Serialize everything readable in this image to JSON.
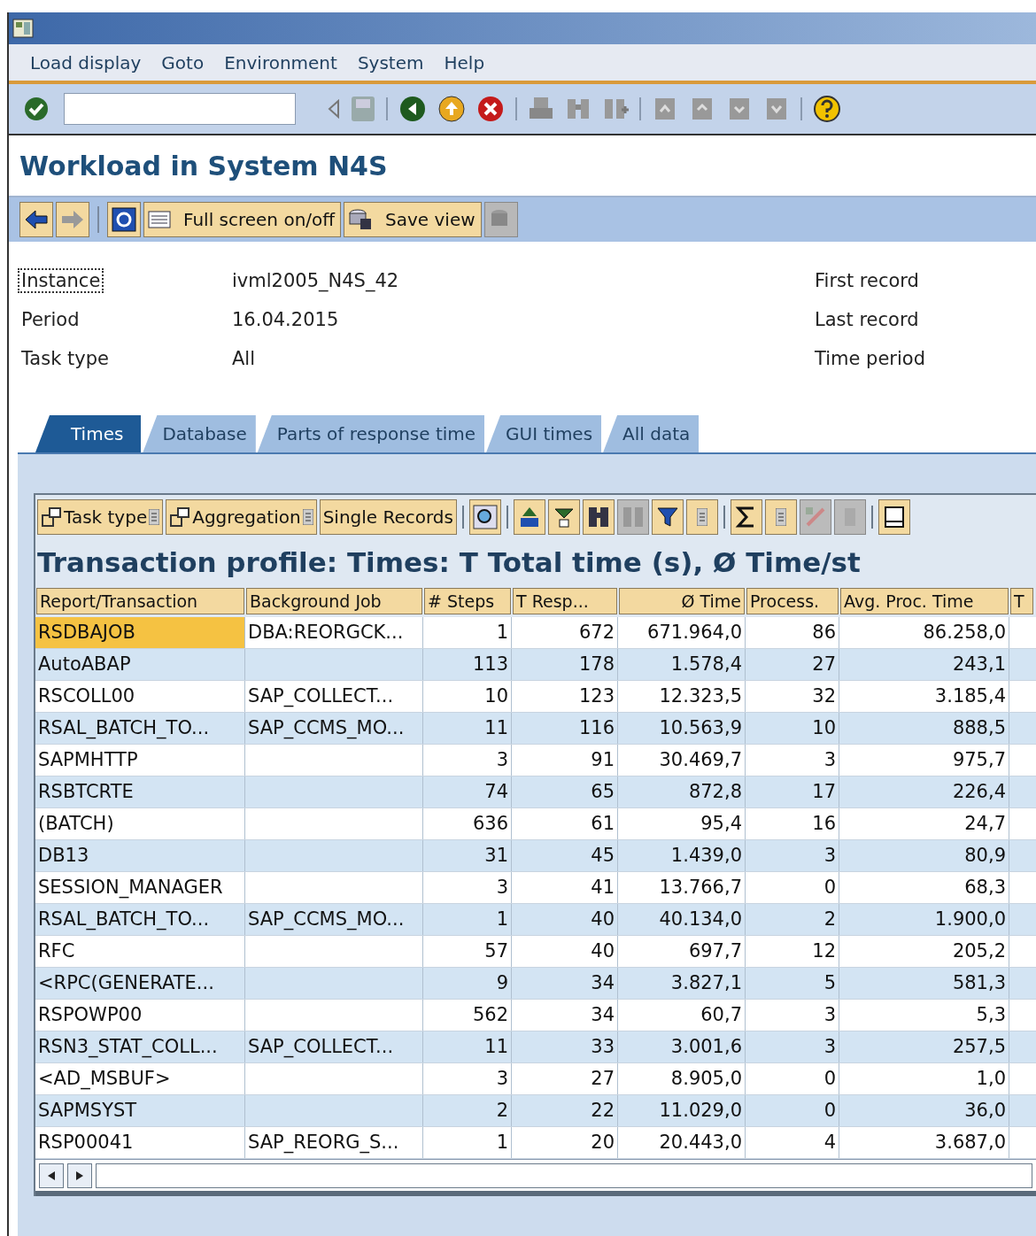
{
  "menu": [
    "Load display",
    "Goto",
    "Environment",
    "System",
    "Help"
  ],
  "title": "Workload in System N4S",
  "app_toolbar": [
    {
      "kind": "back"
    },
    {
      "kind": "forward"
    },
    {
      "kind": "refresh"
    },
    {
      "kind": "fullscreen",
      "label": "Full screen on/off"
    },
    {
      "kind": "save",
      "label": "Save view"
    },
    {
      "kind": "disabled"
    }
  ],
  "info_left": [
    {
      "label": "Instance",
      "value": "ivml2005_N4S_42",
      "focused": true
    },
    {
      "label": "Period",
      "value": "16.04.2015",
      "focused": false
    },
    {
      "label": "Task type",
      "value": "All",
      "focused": false
    }
  ],
  "info_right": [
    "First record",
    "Last record",
    "Time period"
  ],
  "tabs": [
    {
      "label": "Times",
      "selected": true
    },
    {
      "label": "Database",
      "selected": false
    },
    {
      "label": "Parts of response time",
      "selected": false
    },
    {
      "label": "GUI times",
      "selected": false
    },
    {
      "label": "All data",
      "selected": false
    }
  ],
  "grid_toolbar": [
    {
      "label": "Task type",
      "menu": true
    },
    {
      "label": "Aggregation",
      "menu": true
    },
    {
      "label": "Single Records",
      "menu": false
    }
  ],
  "grid": {
    "title": "Transaction profile: Times: T Total time (s), Ø Time/st",
    "columns": [
      "Report/Transaction",
      "Background Job",
      "# Steps",
      "T Resp...",
      "Ø Time",
      "Process.",
      "Avg. Proc. Time",
      "T"
    ],
    "rows": [
      {
        "selected": true,
        "cells": [
          "RSDBAJOB",
          "DBA:REORGCK...",
          "1",
          "672",
          "671.964,0",
          "86",
          "86.258,0"
        ]
      },
      {
        "selected": false,
        "cells": [
          "AutoABAP",
          "",
          "113",
          "178",
          "1.578,4",
          "27",
          "243,1"
        ]
      },
      {
        "selected": false,
        "cells": [
          "RSCOLL00",
          "SAP_COLLECT...",
          "10",
          "123",
          "12.323,5",
          "32",
          "3.185,4"
        ]
      },
      {
        "selected": false,
        "cells": [
          "RSAL_BATCH_TO...",
          "SAP_CCMS_MO...",
          "11",
          "116",
          "10.563,9",
          "10",
          "888,5"
        ]
      },
      {
        "selected": false,
        "cells": [
          "SAPMHTTP",
          "",
          "3",
          "91",
          "30.469,7",
          "3",
          "975,7"
        ]
      },
      {
        "selected": false,
        "cells": [
          "RSBTCRTE",
          "",
          "74",
          "65",
          "872,8",
          "17",
          "226,4"
        ]
      },
      {
        "selected": false,
        "cells": [
          "(BATCH)",
          "",
          "636",
          "61",
          "95,4",
          "16",
          "24,7"
        ]
      },
      {
        "selected": false,
        "cells": [
          "DB13",
          "",
          "31",
          "45",
          "1.439,0",
          "3",
          "80,9"
        ]
      },
      {
        "selected": false,
        "cells": [
          "SESSION_MANAGER",
          "",
          "3",
          "41",
          "13.766,7",
          "0",
          "68,3"
        ]
      },
      {
        "selected": false,
        "cells": [
          "RSAL_BATCH_TO...",
          "SAP_CCMS_MO...",
          "1",
          "40",
          "40.134,0",
          "2",
          "1.900,0"
        ]
      },
      {
        "selected": false,
        "cells": [
          "RFC",
          "",
          "57",
          "40",
          "697,7",
          "12",
          "205,2"
        ]
      },
      {
        "selected": false,
        "cells": [
          "<RPC(GENERATE...",
          "",
          "9",
          "34",
          "3.827,1",
          "5",
          "581,3"
        ]
      },
      {
        "selected": false,
        "cells": [
          "RSPOWP00",
          "",
          "562",
          "34",
          "60,7",
          "3",
          "5,3"
        ]
      },
      {
        "selected": false,
        "cells": [
          "RSN3_STAT_COLL...",
          "SAP_COLLECT...",
          "11",
          "33",
          "3.001,6",
          "3",
          "257,5"
        ]
      },
      {
        "selected": false,
        "cells": [
          "<AD_MSBUF>",
          "",
          "3",
          "27",
          "8.905,0",
          "0",
          "1,0"
        ]
      },
      {
        "selected": false,
        "cells": [
          "SAPMSYST",
          "",
          "2",
          "22",
          "11.029,0",
          "0",
          "36,0"
        ]
      },
      {
        "selected": false,
        "cells": [
          "RSP00041",
          "SAP_REORG_S...",
          "1",
          "20",
          "20.443,0",
          "4",
          "3.687,0"
        ]
      }
    ]
  }
}
